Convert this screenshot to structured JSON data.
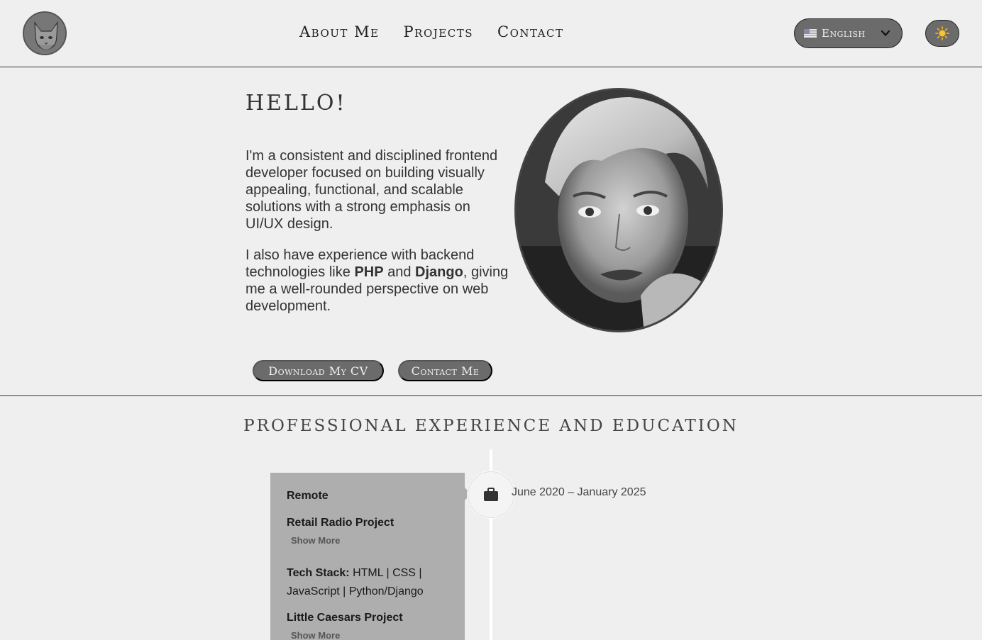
{
  "header": {
    "nav": [
      "About Me",
      "Projects",
      "Contact"
    ],
    "language": "English",
    "language_flag_icon": "us-flag-icon",
    "theme_icon": "sun-icon"
  },
  "hero": {
    "title": "HELLO!",
    "paragraph1": "I'm a consistent and disciplined frontend developer focused on building visually appealing, functional, and scalable solutions with a strong emphasis on UI/UX design.",
    "paragraph2_parts": {
      "a": "I also have experience with backend technologies like ",
      "php": "PHP",
      "b": " and ",
      "django": "Django",
      "c": ", giving me a well-rounded perspective on web development."
    },
    "buttons": {
      "cv": "Download My CV",
      "contact": "Contact Me"
    }
  },
  "experience": {
    "title": "PROFESSIONAL EXPERIENCE AND EDUCATION",
    "items": [
      {
        "location": "Remote",
        "date": "June 2020 – January 2025",
        "icon": "briefcase-icon",
        "projects": [
          {
            "title": "Retail Radio Project",
            "show_more": "Show More"
          },
          {
            "title": "Little Caesars Project",
            "show_more": "Show More"
          }
        ],
        "tech_label": "Tech Stack:",
        "tech_values": " HTML | CSS | JavaScript | Python/Django"
      }
    ]
  },
  "colors": {
    "background": "#efefef",
    "button": "#6b6b6b",
    "card": "#aeaeae"
  }
}
